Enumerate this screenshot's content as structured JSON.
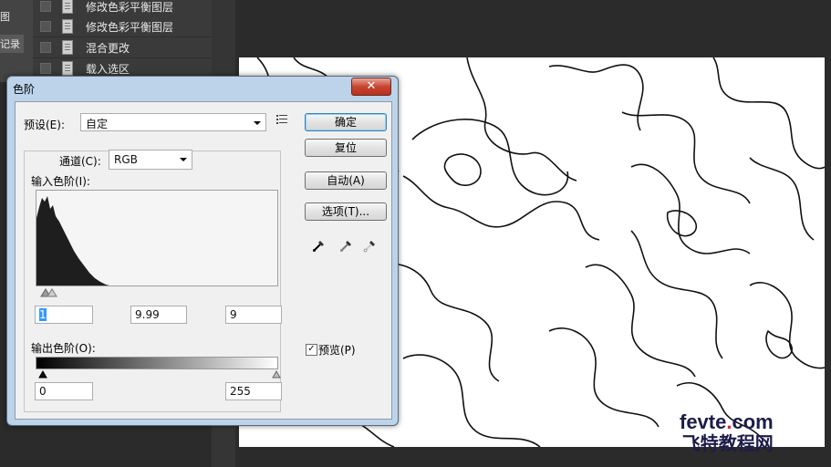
{
  "history_panel": {
    "left_labels": [
      "图",
      "记录"
    ],
    "items": [
      "修改色彩平衡图层",
      "修改色彩平衡图层",
      "混合更改",
      "载入选区"
    ]
  },
  "dialog": {
    "title": "色阶",
    "close_label": "✕",
    "preset_label": "预设(E):",
    "preset_value": "自定",
    "channel_label": "通道(C):",
    "channel_value": "RGB",
    "input_levels_label": "输入色阶(I):",
    "input_black": "1",
    "input_gamma": "9.99",
    "input_white": "9",
    "output_levels_label": "输出色阶(O):",
    "output_black": "0",
    "output_white": "255",
    "buttons": {
      "ok": "确定",
      "reset": "复位",
      "auto": "自动(A)",
      "options": "选项(T)..."
    },
    "preview_label": "预览(P)",
    "preview_checked": "✓"
  },
  "watermark": {
    "line1_a": "fevte",
    "line1_dot": ".",
    "line1_b": "com",
    "line2": "飞特教程网"
  },
  "colors": {
    "dialog_frame": "#bcd3ea",
    "client_bg": "#f0f0f0",
    "close_red": "#c7442f",
    "panel_dark": "#3c3c3c"
  }
}
